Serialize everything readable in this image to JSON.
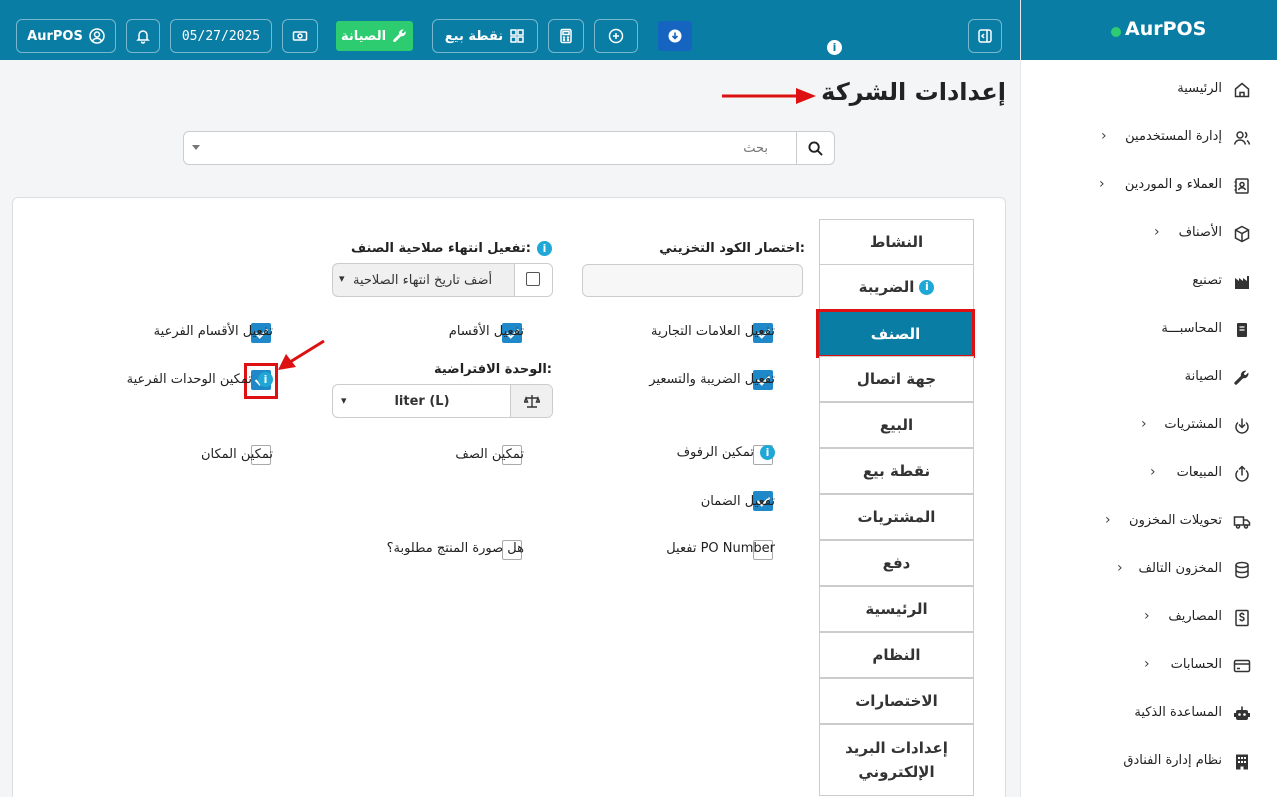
{
  "topbar": {
    "user_label": "AurPOS",
    "date": "05/27/2025",
    "maintenance_label": "الصيانة",
    "pos_label": "نقطة بيع",
    "info_glyph": "i"
  },
  "sidebar": {
    "brand": "AurPOS",
    "items": [
      {
        "label": "الرئيسية",
        "icon": "home-icon"
      },
      {
        "label": "إدارة المستخدمين",
        "icon": "users-icon"
      },
      {
        "label": "العملاء و الموردين",
        "icon": "address-book-icon"
      },
      {
        "label": "الأصناف",
        "icon": "box-icon"
      },
      {
        "label": "تصنيع",
        "icon": "factory-icon"
      },
      {
        "label": "المحاسبـــة",
        "icon": "ledger-icon"
      },
      {
        "label": "الصيانة",
        "icon": "wrench-icon"
      },
      {
        "label": "المشتريات",
        "icon": "download-icon"
      },
      {
        "label": "المبيعات",
        "icon": "upload-icon"
      },
      {
        "label": "تحويلات المخزون",
        "icon": "truck-icon"
      },
      {
        "label": "المخزون التالف",
        "icon": "database-icon"
      },
      {
        "label": "المصاريف",
        "icon": "dollar-icon"
      },
      {
        "label": "الحسابات",
        "icon": "card-icon"
      },
      {
        "label": "المساعدة الذكية",
        "icon": "robot-icon"
      },
      {
        "label": "نظام إدارة الفنادق",
        "icon": "hotel-icon"
      }
    ]
  },
  "page": {
    "title": "إعدادات الشركة",
    "search_placeholder": "بحث"
  },
  "tabs": [
    {
      "label": "النشاط"
    },
    {
      "label": "الضريبة"
    },
    {
      "label": "الصنف"
    },
    {
      "label": "جهة اتصال"
    },
    {
      "label": "البيع"
    },
    {
      "label": "نقطة بيع"
    },
    {
      "label": "المشتريات"
    },
    {
      "label": "دفع"
    },
    {
      "label": "الرئيسية"
    },
    {
      "label": "النظام"
    },
    {
      "label": "الاختصارات"
    },
    {
      "label": "إعدادات البريد الإلكتروني"
    }
  ],
  "form": {
    "sku_prefix_label": "اختصار الكود التخزيني:",
    "sku_prefix_value": "",
    "expiry_label": "تفعيل انتهاء صلاحية الصنف:",
    "expiry_checkbox_label": "أضف تاريخ انتهاء الصلاحية",
    "expiry_select_value": "أضف تاريخ انتهاء الصلاحية",
    "brands_label": "تفعيل العلامات التجارية",
    "categories_label": "تفعيل الأقسام",
    "subcategories_label": "تفعيل الأقسام الفرعية",
    "price_tax_label": "تفعيل الضريبة والتسعير",
    "default_unit_label": "الوحدة الافتراضية:",
    "default_unit_value": "liter (L)",
    "sub_units_label": "تمكين الوحدات الفرعية",
    "racks_label": "تمكين الرفوف",
    "row_label": "تمكين الصف",
    "position_label": "تمكين المكان",
    "warranty_label": "تفعيل الضمان",
    "po_number_label": "تفعيل PO Number",
    "image_required_label": "هل صورة المنتج مطلوبة؟"
  },
  "colors": {
    "primary": "#0a7da4",
    "accent_green": "#2ecc71",
    "checkbox_blue": "#1e88c8",
    "highlight_red": "#dd1111"
  }
}
